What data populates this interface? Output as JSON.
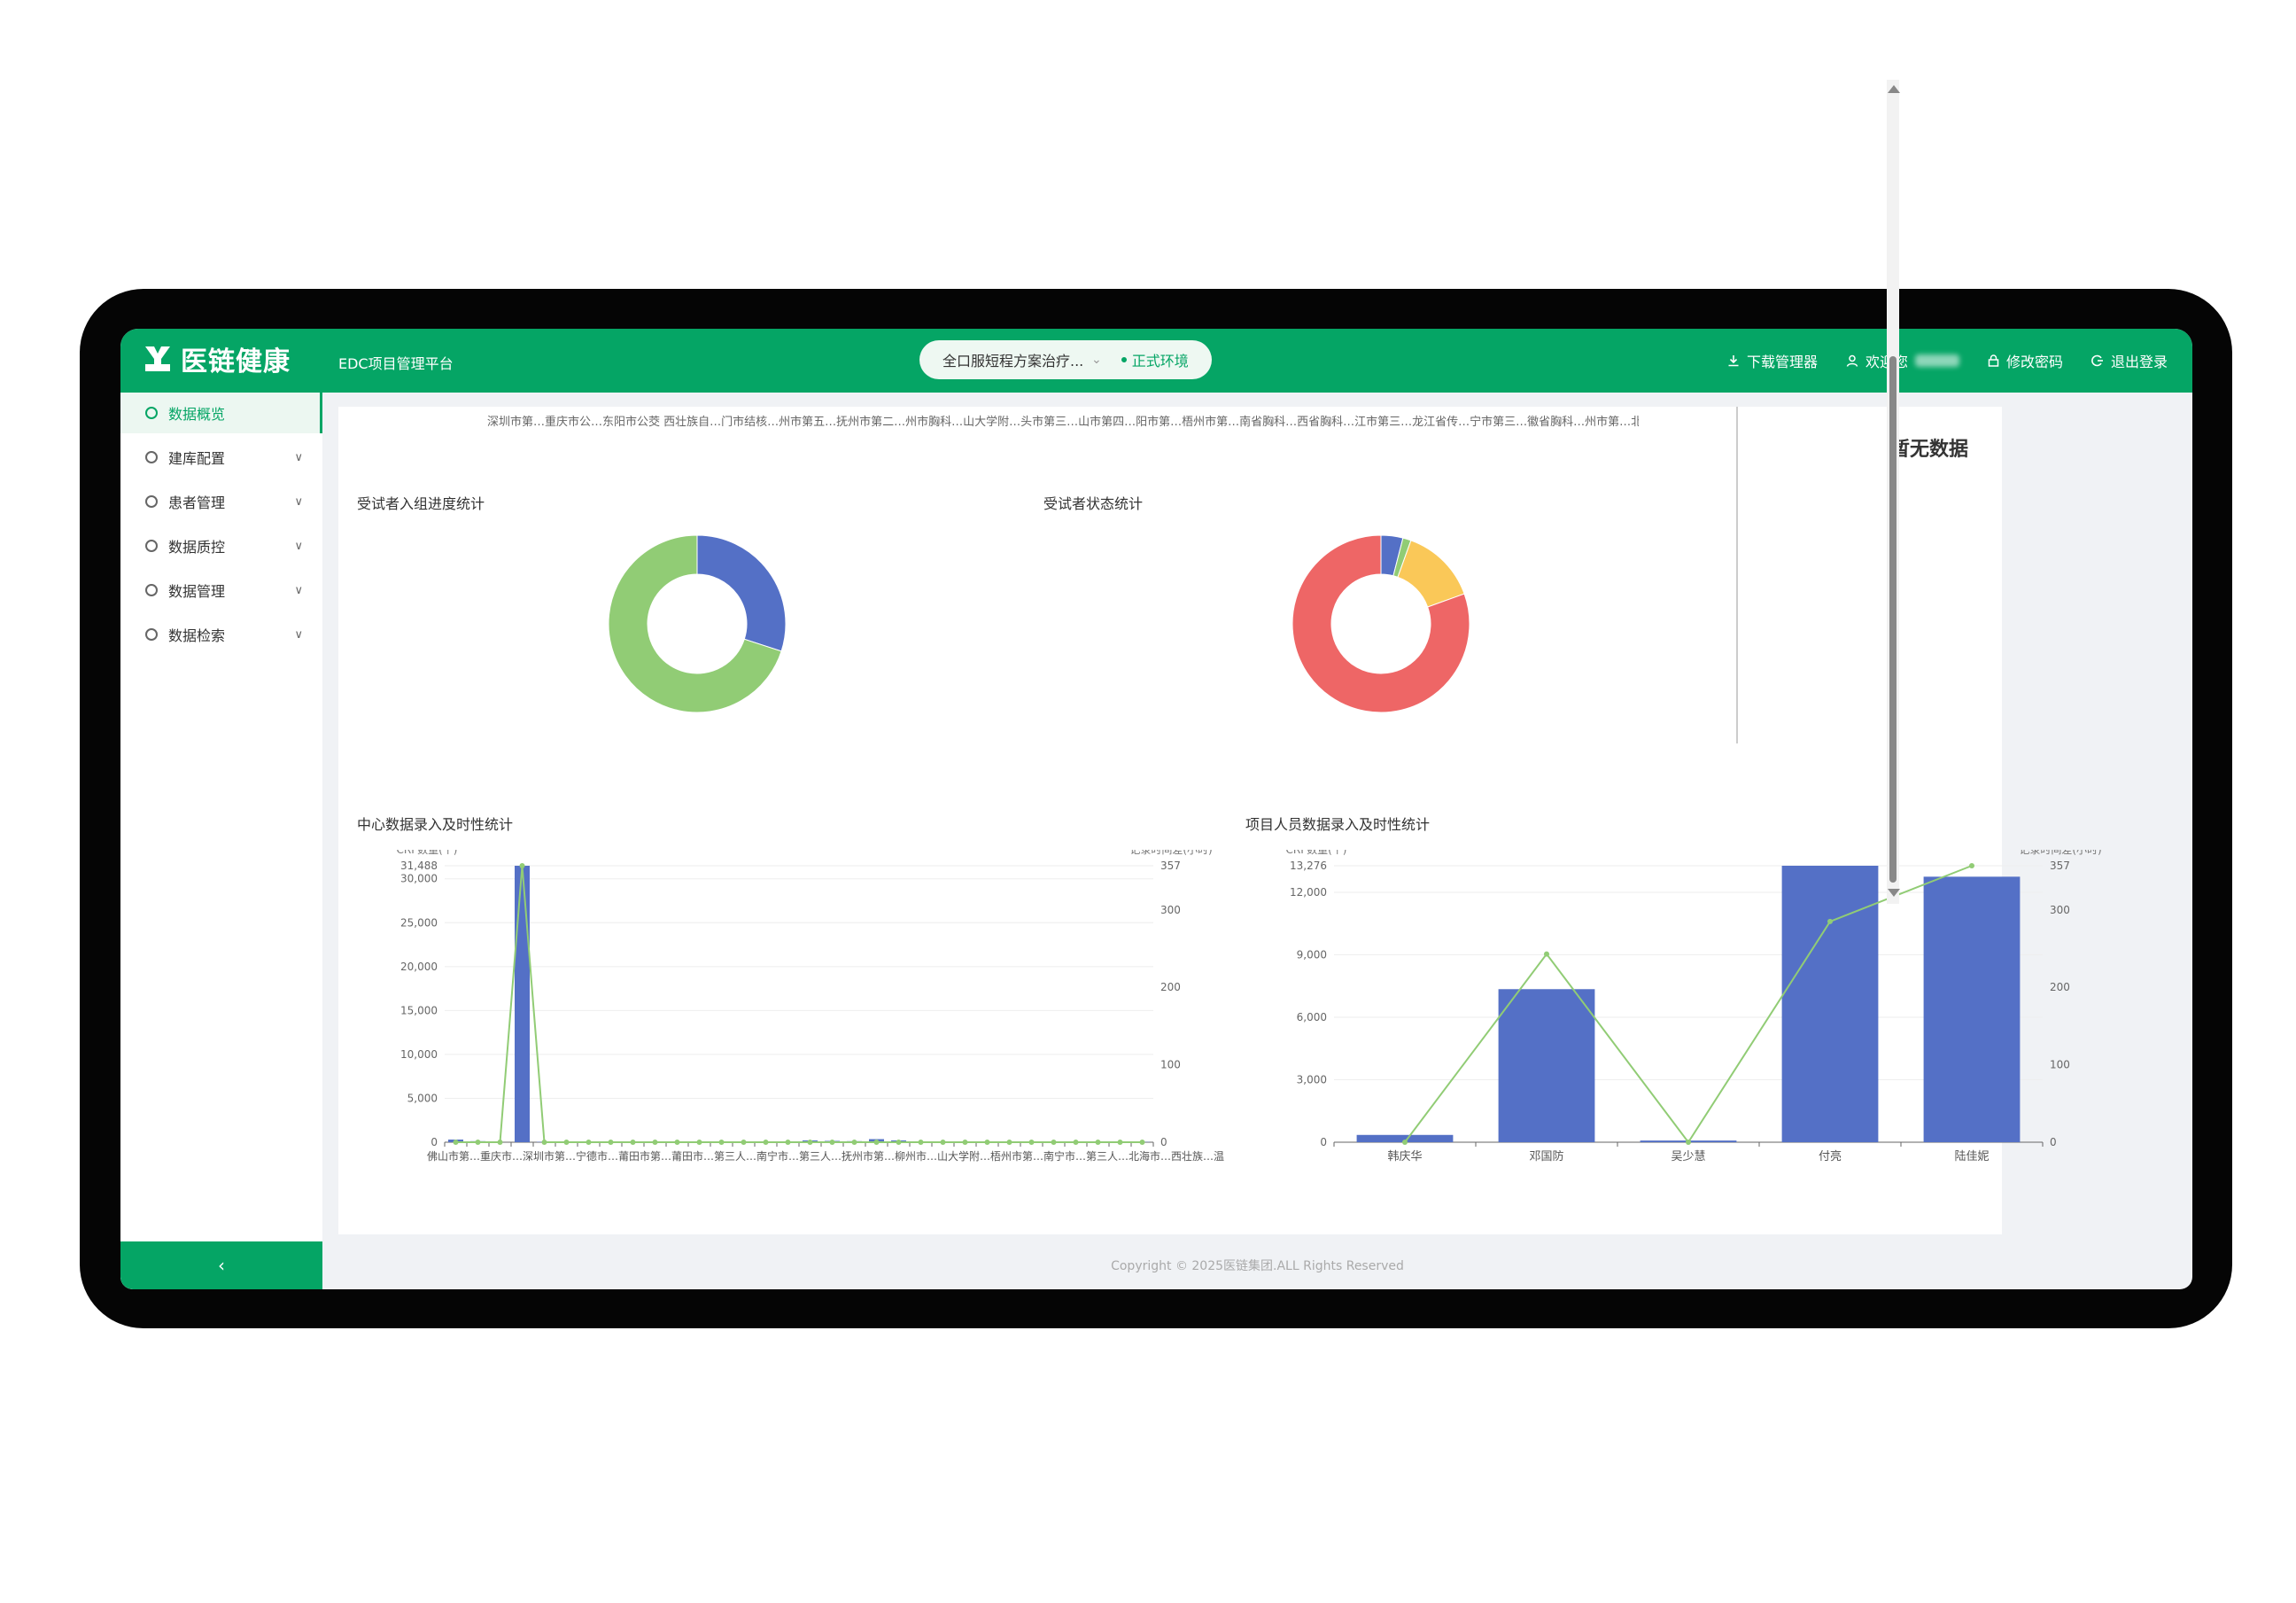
{
  "app": {
    "brand": "医链健康",
    "platform": "EDC项目管理平台",
    "project_name": "全口服短程方案治疗...",
    "environment": "正式环境",
    "download_manager": "下载管理器",
    "welcome": "欢迎您",
    "change_password": "修改密码",
    "logout": "退出登录",
    "brand_color": "#05a565"
  },
  "sidebar": {
    "items": [
      {
        "label": "数据概览",
        "active": true
      },
      {
        "label": "建库配置",
        "has_children": true
      },
      {
        "label": "患者管理",
        "has_children": true
      },
      {
        "label": "数据质控",
        "has_children": true
      },
      {
        "label": "数据管理",
        "has_children": true
      },
      {
        "label": "数据检索",
        "has_children": true
      }
    ],
    "collapse_icon": "‹"
  },
  "overview": {
    "center_ticker": "深圳市第…重庆市公…东阳市公茭 西壮族自…门市结核…州市第五…抚州市第二…州市胸科…山大学附…头市第三…山市第四…阳市第…梧州市第…南省胸科…西省胸科…江市第三…龙江省传…宁市第三…徽省胸科…州市第…北海市结核…",
    "no_data": "暂无数据"
  },
  "chart_data": [
    {
      "type": "pie",
      "title": "受试者入组进度统计",
      "donut": true,
      "slices": [
        {
          "value": 30,
          "color": "#5470c6"
        },
        {
          "value": 70,
          "color": "#91cc75"
        }
      ]
    },
    {
      "type": "pie",
      "title": "受试者状态统计",
      "donut": true,
      "slices": [
        {
          "value": 4,
          "color": "#5470c6"
        },
        {
          "value": 1.5,
          "color": "#91cc75"
        },
        {
          "value": 14,
          "color": "#fac858"
        },
        {
          "value": 80.5,
          "color": "#ee6666"
        }
      ]
    },
    {
      "type": "bar",
      "title": "中心数据录入及时性统计",
      "y_left_label": "CRF数量(个)",
      "y_right_label": "记录时间差(小时)",
      "y_left_ticks": [
        "0",
        "5,000",
        "10,000",
        "15,000",
        "20,000",
        "25,000",
        "30,000"
      ],
      "y_left_ticks_values": [
        0,
        5000,
        10000,
        15000,
        20000,
        25000,
        30000
      ],
      "y_left_max": 31488,
      "y_left_max_label": "31,488",
      "y_right_ticks": [
        "0",
        "100",
        "200",
        "300"
      ],
      "y_right_ticks_values": [
        0,
        100,
        200,
        300
      ],
      "y_right_max": 357,
      "y_right_max_label": "357",
      "x_axis_text": "佛山市第…重庆市…深圳市第…宁德市…莆田市第…莆田市…第三人…南宁市…第三人…抚州市第…柳州市…山大学附…梧州市第…南宁市…第三人…北海市…西壮族…温州市…阳市第…江西省…南京市第…景德镇…广州市…第四…",
      "series": [
        {
          "name": "CRF数量(个)",
          "kind": "bar",
          "color": "#5470c6",
          "values": [
            300,
            120,
            0,
            31488,
            40,
            50,
            80,
            60,
            30,
            40,
            60,
            40,
            20,
            30,
            50,
            40,
            200,
            150,
            120,
            350,
            200,
            100,
            80,
            60,
            50,
            40,
            100,
            60,
            80,
            50,
            40,
            30
          ]
        },
        {
          "name": "记录时间差(小时)",
          "kind": "line",
          "color": "#91cc75",
          "values": [
            0,
            0,
            0,
            357,
            0,
            0,
            0,
            0,
            0,
            0,
            0,
            0,
            0,
            0,
            0,
            0,
            0,
            0,
            0,
            0,
            0,
            0,
            0,
            0,
            0,
            0,
            0,
            0,
            0,
            0,
            0,
            0
          ]
        }
      ]
    },
    {
      "type": "bar",
      "title": "项目人员数据录入及时性统计",
      "y_left_label": "CRF数量(个)",
      "y_right_label": "记录时间差(小时)",
      "y_left_ticks": [
        "0",
        "3,000",
        "6,000",
        "9,000",
        "12,000"
      ],
      "y_left_ticks_values": [
        0,
        3000,
        6000,
        9000,
        12000
      ],
      "y_left_max": 13276,
      "y_left_max_label": "13,276",
      "y_right_ticks": [
        "0",
        "100",
        "200",
        "300"
      ],
      "y_right_ticks_values": [
        0,
        100,
        200,
        300
      ],
      "y_right_max": 357,
      "y_right_max_label": "357",
      "categories": [
        "韩庆华",
        "邓国防",
        "吴少慧",
        "付亮",
        "陆佳妮"
      ],
      "series": [
        {
          "name": "CRF数量(个)",
          "kind": "bar",
          "color": "#5470c6",
          "values": [
            350,
            7350,
            80,
            13276,
            12750
          ]
        },
        {
          "name": "记录时间差(小时)",
          "kind": "line",
          "color": "#91cc75",
          "values": [
            0,
            243,
            0,
            285,
            357
          ]
        }
      ]
    }
  ],
  "footer": {
    "copyright": "Copyright © 2025医链集团.ALL Rights Reserved"
  }
}
